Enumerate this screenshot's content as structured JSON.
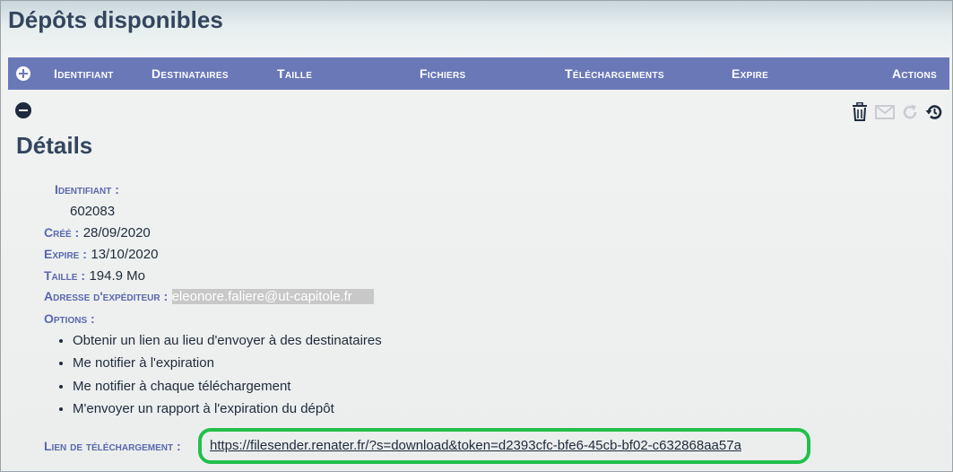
{
  "page": {
    "title": "Dépôts disponibles"
  },
  "table_header": {
    "columns": [
      "Identifiant",
      "Destinataires",
      "Taille",
      "Fichiers",
      "Téléchargements",
      "Expire",
      "Actions"
    ]
  },
  "details": {
    "title": "Détails",
    "identifiant_label": "Identifiant :",
    "identifiant_value": "602083",
    "cree_label": "Créé :",
    "cree_value": "28/09/2020",
    "expire_label": "Expire :",
    "expire_value": "13/10/2020",
    "taille_label": "Taille :",
    "taille_value": "194.9 Mo",
    "sender_label": "Adresse d'expéditeur :",
    "sender_value": "eleonore.faliere@ut-capitole.fr",
    "options_label": "Options :",
    "options": [
      "Obtenir un lien au lieu d'envoyer à des destinataires",
      "Me notifier à l'expiration",
      "Me notifier à chaque téléchargement",
      "M'envoyer un rapport à l'expiration du dépôt"
    ],
    "download_link_label": "Lien de téléchargement :",
    "download_link": "https://filesender.renater.fr/?s=download&token=d2393cfc-bfe6-45cb-bf02-c632868aa57a"
  },
  "icons": {
    "expand": "plus-circle-icon",
    "collapse": "minus-circle-icon",
    "delete": "trash-icon",
    "email": "envelope-icon",
    "resend": "refresh-icon",
    "extend": "history-icon"
  },
  "colors": {
    "header_bar": "#6b78b8",
    "title": "#33455e",
    "label": "#5a67ad",
    "highlight": "#22c04a"
  }
}
